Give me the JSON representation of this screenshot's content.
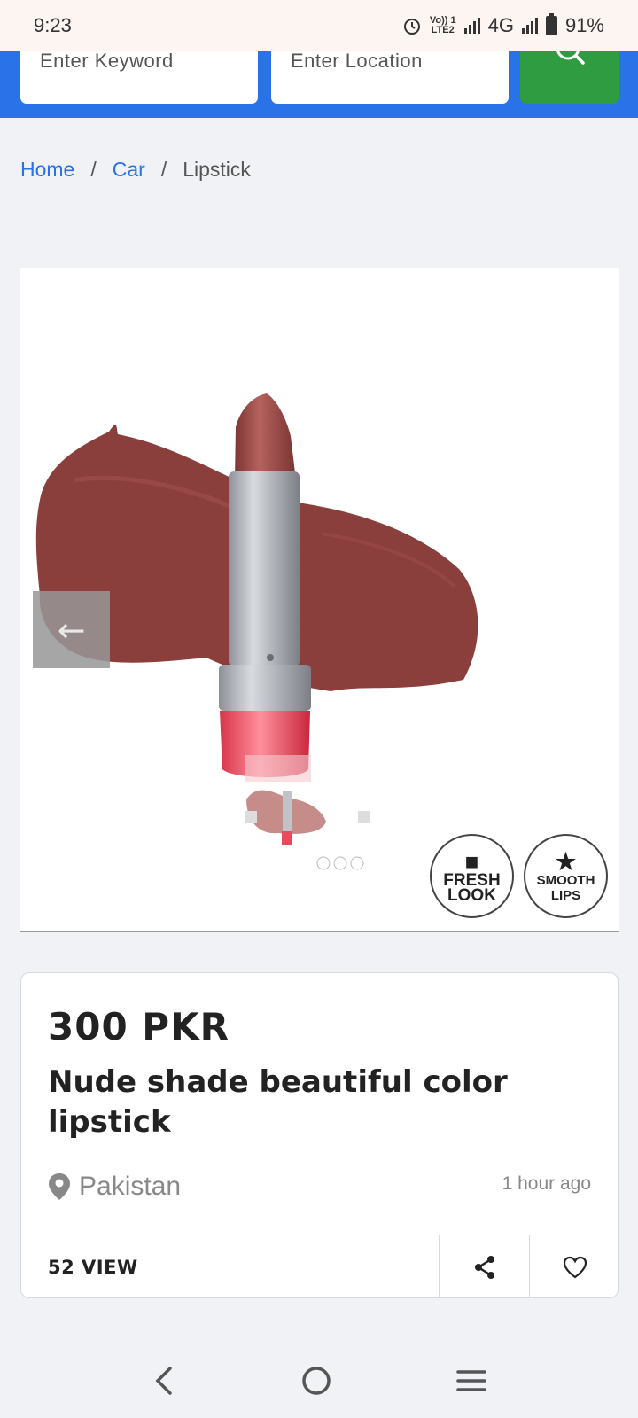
{
  "status_bar": {
    "time": "9:23",
    "volte_top": "Vo)) 1",
    "volte_bottom": "LTE2",
    "network": "4G",
    "battery": "91%"
  },
  "search": {
    "keyword_placeholder": "Enter Keyword",
    "location_placeholder": "Enter Location"
  },
  "breadcrumb": {
    "items": [
      "Home",
      "Car",
      "Lipstick"
    ],
    "separator": "/"
  },
  "gallery": {
    "prev_arrow": "←",
    "badges": [
      {
        "symbol": "■",
        "line1": "FRESH",
        "line2": "LOOK"
      },
      {
        "symbol": "★",
        "line1": "SMOOTH",
        "line2": "LIPS"
      }
    ]
  },
  "listing": {
    "price": "300 PKR",
    "title": "Nude shade beautiful color lipstick",
    "location": "Pakistan",
    "posted": "1 hour ago",
    "views": "52 VIEW"
  },
  "colors": {
    "header_blue": "#2a72e8",
    "search_green": "#2f9c41",
    "lipstick": "#8b3f3d"
  }
}
